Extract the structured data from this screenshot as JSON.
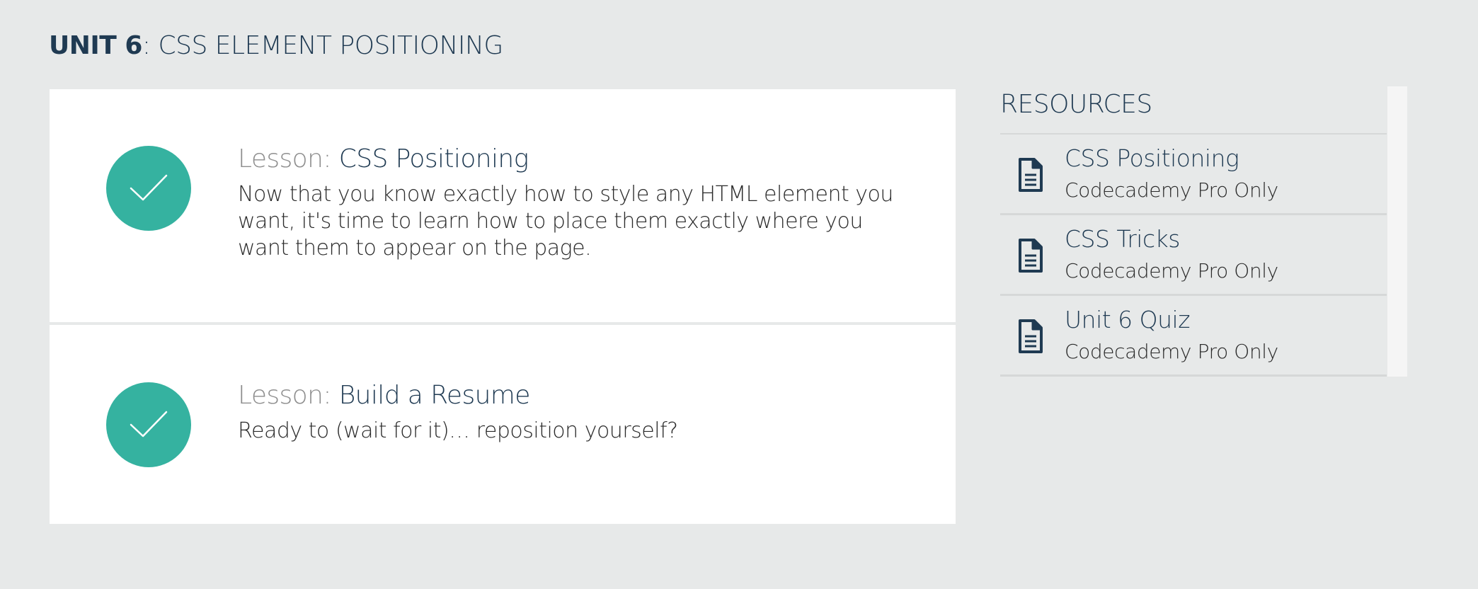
{
  "unit": {
    "number_label": "UNIT 6",
    "title": ": CSS ELEMENT POSITIONING"
  },
  "lessons": [
    {
      "prefix": "Lesson: ",
      "name": "CSS Positioning",
      "description": "Now that you know exactly how to style any HTML element you want, it's time to learn how to place them exactly where you want them to appear on the page.",
      "completed": true
    },
    {
      "prefix": "Lesson: ",
      "name": "Build a Resume",
      "description": "Ready to (wait for it)… reposition yourself?",
      "completed": true
    }
  ],
  "resources": {
    "title": "RESOURCES",
    "items": [
      {
        "name": "CSS Positioning",
        "subtitle": "Codecademy Pro Only",
        "icon": "document-icon"
      },
      {
        "name": "CSS Tricks",
        "subtitle": "Codecademy Pro Only",
        "icon": "document-icon"
      },
      {
        "name": "Unit 6 Quiz",
        "subtitle": "Codecademy Pro Only",
        "icon": "document-icon"
      }
    ]
  },
  "colors": {
    "background": "#e7e9e9",
    "navy": "#1f3a52",
    "check_teal": "#35b2a0",
    "muted_gray": "#8e8e8e"
  }
}
